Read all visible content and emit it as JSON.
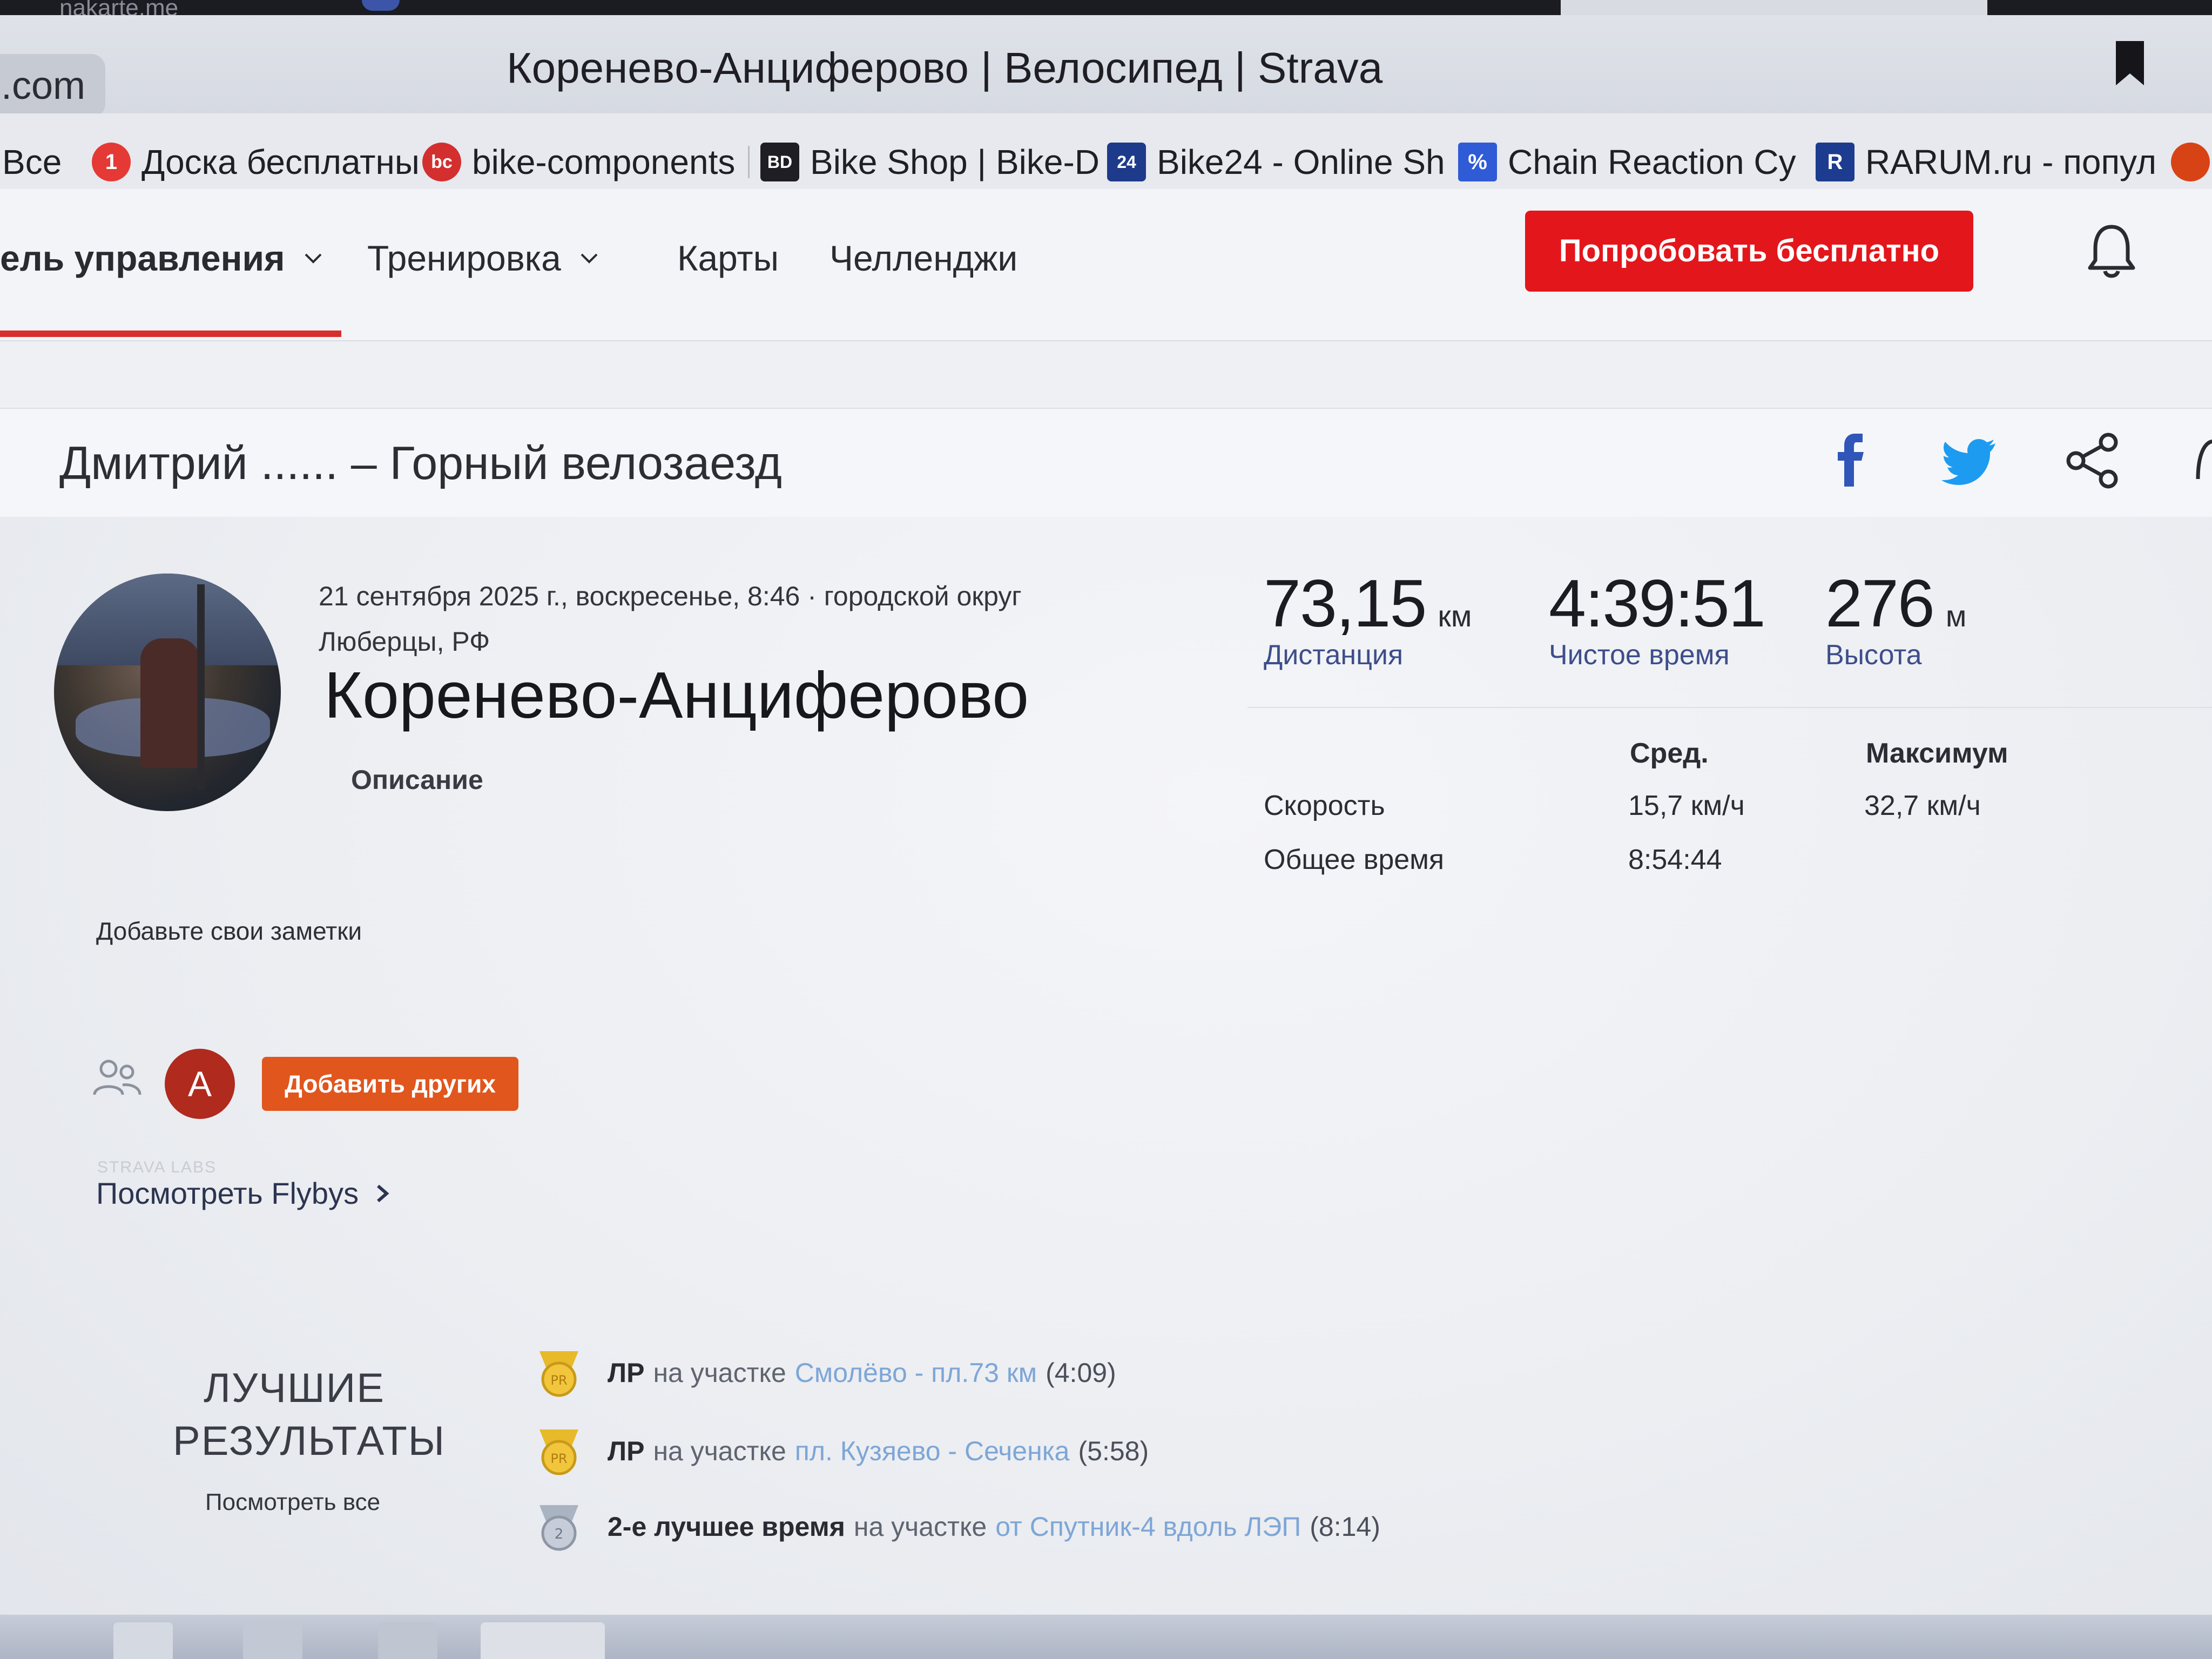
{
  "os_strip": {
    "tab_text": "nakarte.me"
  },
  "browser": {
    "url_fragment": ".com",
    "page_title": "Кореневo-Анциферово | Велосипед | Strava"
  },
  "bookmarks": [
    {
      "label": "Все",
      "icon": "none",
      "color": ""
    },
    {
      "label": "Доска бесплатны",
      "icon": "badge-icon",
      "icon_text": "1",
      "color": "#e53935"
    },
    {
      "label": "bike-components",
      "icon": "bike-components-icon",
      "icon_text": "bc",
      "color": "#d32f2f"
    },
    {
      "label": "Bike Shop | Bike-D",
      "icon": "bike-discount-icon",
      "icon_text": "BD",
      "color": "#1e1e24"
    },
    {
      "label": "Bike24 - Online Sh",
      "icon": "bike24-icon",
      "icon_text": "24",
      "color": "#1e3a8a"
    },
    {
      "label": "Chain Reaction Cy",
      "icon": "chain-reaction-icon",
      "icon_text": "%",
      "color": "#2f5bd6"
    },
    {
      "label": "RARUM.ru - попул",
      "icon": "rarum-icon",
      "icon_text": "R",
      "color": "#1d3b8f"
    }
  ],
  "nav": {
    "dashboard": "ель управления",
    "training": "Тренировка",
    "maps": "Карты",
    "challenges": "Челленджи",
    "try_free": "Попробовать бесплатно"
  },
  "activity": {
    "heading": "Дмитрий ...... – Горный велозаезд",
    "date_line1": "21 сентября 2025 г., воскресенье, 8:46 · городской округ",
    "date_line2": "Люберцы, РФ",
    "name": "Кореневo-Анциферово",
    "description_label": "Описание",
    "notes_link": "Добавьте свои заметки"
  },
  "stats": {
    "distance": {
      "value": "73,15",
      "unit": "км",
      "label": "Дистанция"
    },
    "moving_time": {
      "value": "4:39:51",
      "label": "Чистое время"
    },
    "elevation": {
      "value": "276",
      "unit": "м",
      "label": "Высота"
    }
  },
  "stats_table": {
    "col_avg": "Сред.",
    "col_max": "Максимум",
    "rows": [
      {
        "label": "Скорость",
        "avg": "15,7 км/ч",
        "max": "32,7 км/ч"
      },
      {
        "label": "Общее время",
        "avg": "8:54:44",
        "max": ""
      }
    ]
  },
  "social": {
    "athlete_initial": "А",
    "add_others": "Добавить других",
    "labs_tag": "STRAVA LABS",
    "flybys": "Посмотреть Flybys"
  },
  "best": {
    "title_line1": "ЛУЧШИЕ",
    "title_line2": "РЕЗУЛЬТАТЫ",
    "view_all": "Посмотреть все",
    "items": [
      {
        "rank": "ЛР",
        "pre": "на участке",
        "segment": "Смолёво - пл.73 км",
        "time": "(4:09)",
        "medal": "gold"
      },
      {
        "rank": "ЛР",
        "pre": "на участке",
        "segment": "пл. Кузяево - Сеченка",
        "time": "(5:58)",
        "medal": "gold"
      },
      {
        "rank": "2-е лучшее время",
        "pre": "на участке",
        "segment": "от Спутник-4 вдоль ЛЭП",
        "time": "(8:14)",
        "medal": "silver"
      }
    ]
  },
  "colors": {
    "strava_red": "#e3161c",
    "strava_orange": "#e0561d",
    "label_blue": "#3e4e8a",
    "segment_blue": "#7ea6d6"
  }
}
